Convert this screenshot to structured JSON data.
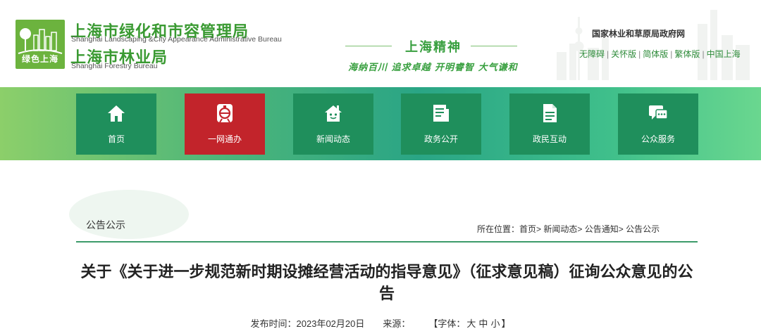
{
  "header": {
    "logo_text": "绿色上海",
    "org1_cn": "上海市绿化和市容管理局",
    "org1_en": "Shanghai Landscaping &City Appearance Administrative Bureau",
    "org2_cn": "上海市林业局",
    "org2_en": "Shanghai Forestry Bureau",
    "slogan_title": "上海精神",
    "slogan_sub": "海纳百川 追求卓越 开明睿智 大气谦和",
    "gov_link": "国家林业和草原局政府网",
    "versions": [
      "无障碍",
      "关怀版",
      "简体版",
      "繁体版",
      "中国上海"
    ],
    "brand_color": "#3a9a32"
  },
  "nav": {
    "items": [
      {
        "label": "首页",
        "icon": "home-icon"
      },
      {
        "label": "一网通办",
        "icon": "service-portal-icon",
        "active": true
      },
      {
        "label": "新闻动态",
        "icon": "news-house-icon"
      },
      {
        "label": "政务公开",
        "icon": "document-list-icon"
      },
      {
        "label": "政民互动",
        "icon": "file-edit-icon"
      },
      {
        "label": "公众服务",
        "icon": "chat-icon"
      }
    ],
    "active_color": "#c2242b",
    "item_color": "#1f8f5c"
  },
  "section": {
    "title": "公告公示",
    "breadcrumb_prefix": "所在位置：",
    "breadcrumb": [
      "首页",
      "新闻动态",
      "公告通知",
      "公告公示"
    ]
  },
  "article": {
    "title": "关于《关于进一步规范新时期设摊经营活动的指导意见》（征求意见稿）征询公众意见的公告",
    "publish_label": "发布时间：",
    "publish_date": "2023年02月20日",
    "source_label": "来源：",
    "fontsize_open": "【字体：",
    "fontsize_options": [
      "大",
      "中",
      "小"
    ],
    "fontsize_close": "】"
  }
}
